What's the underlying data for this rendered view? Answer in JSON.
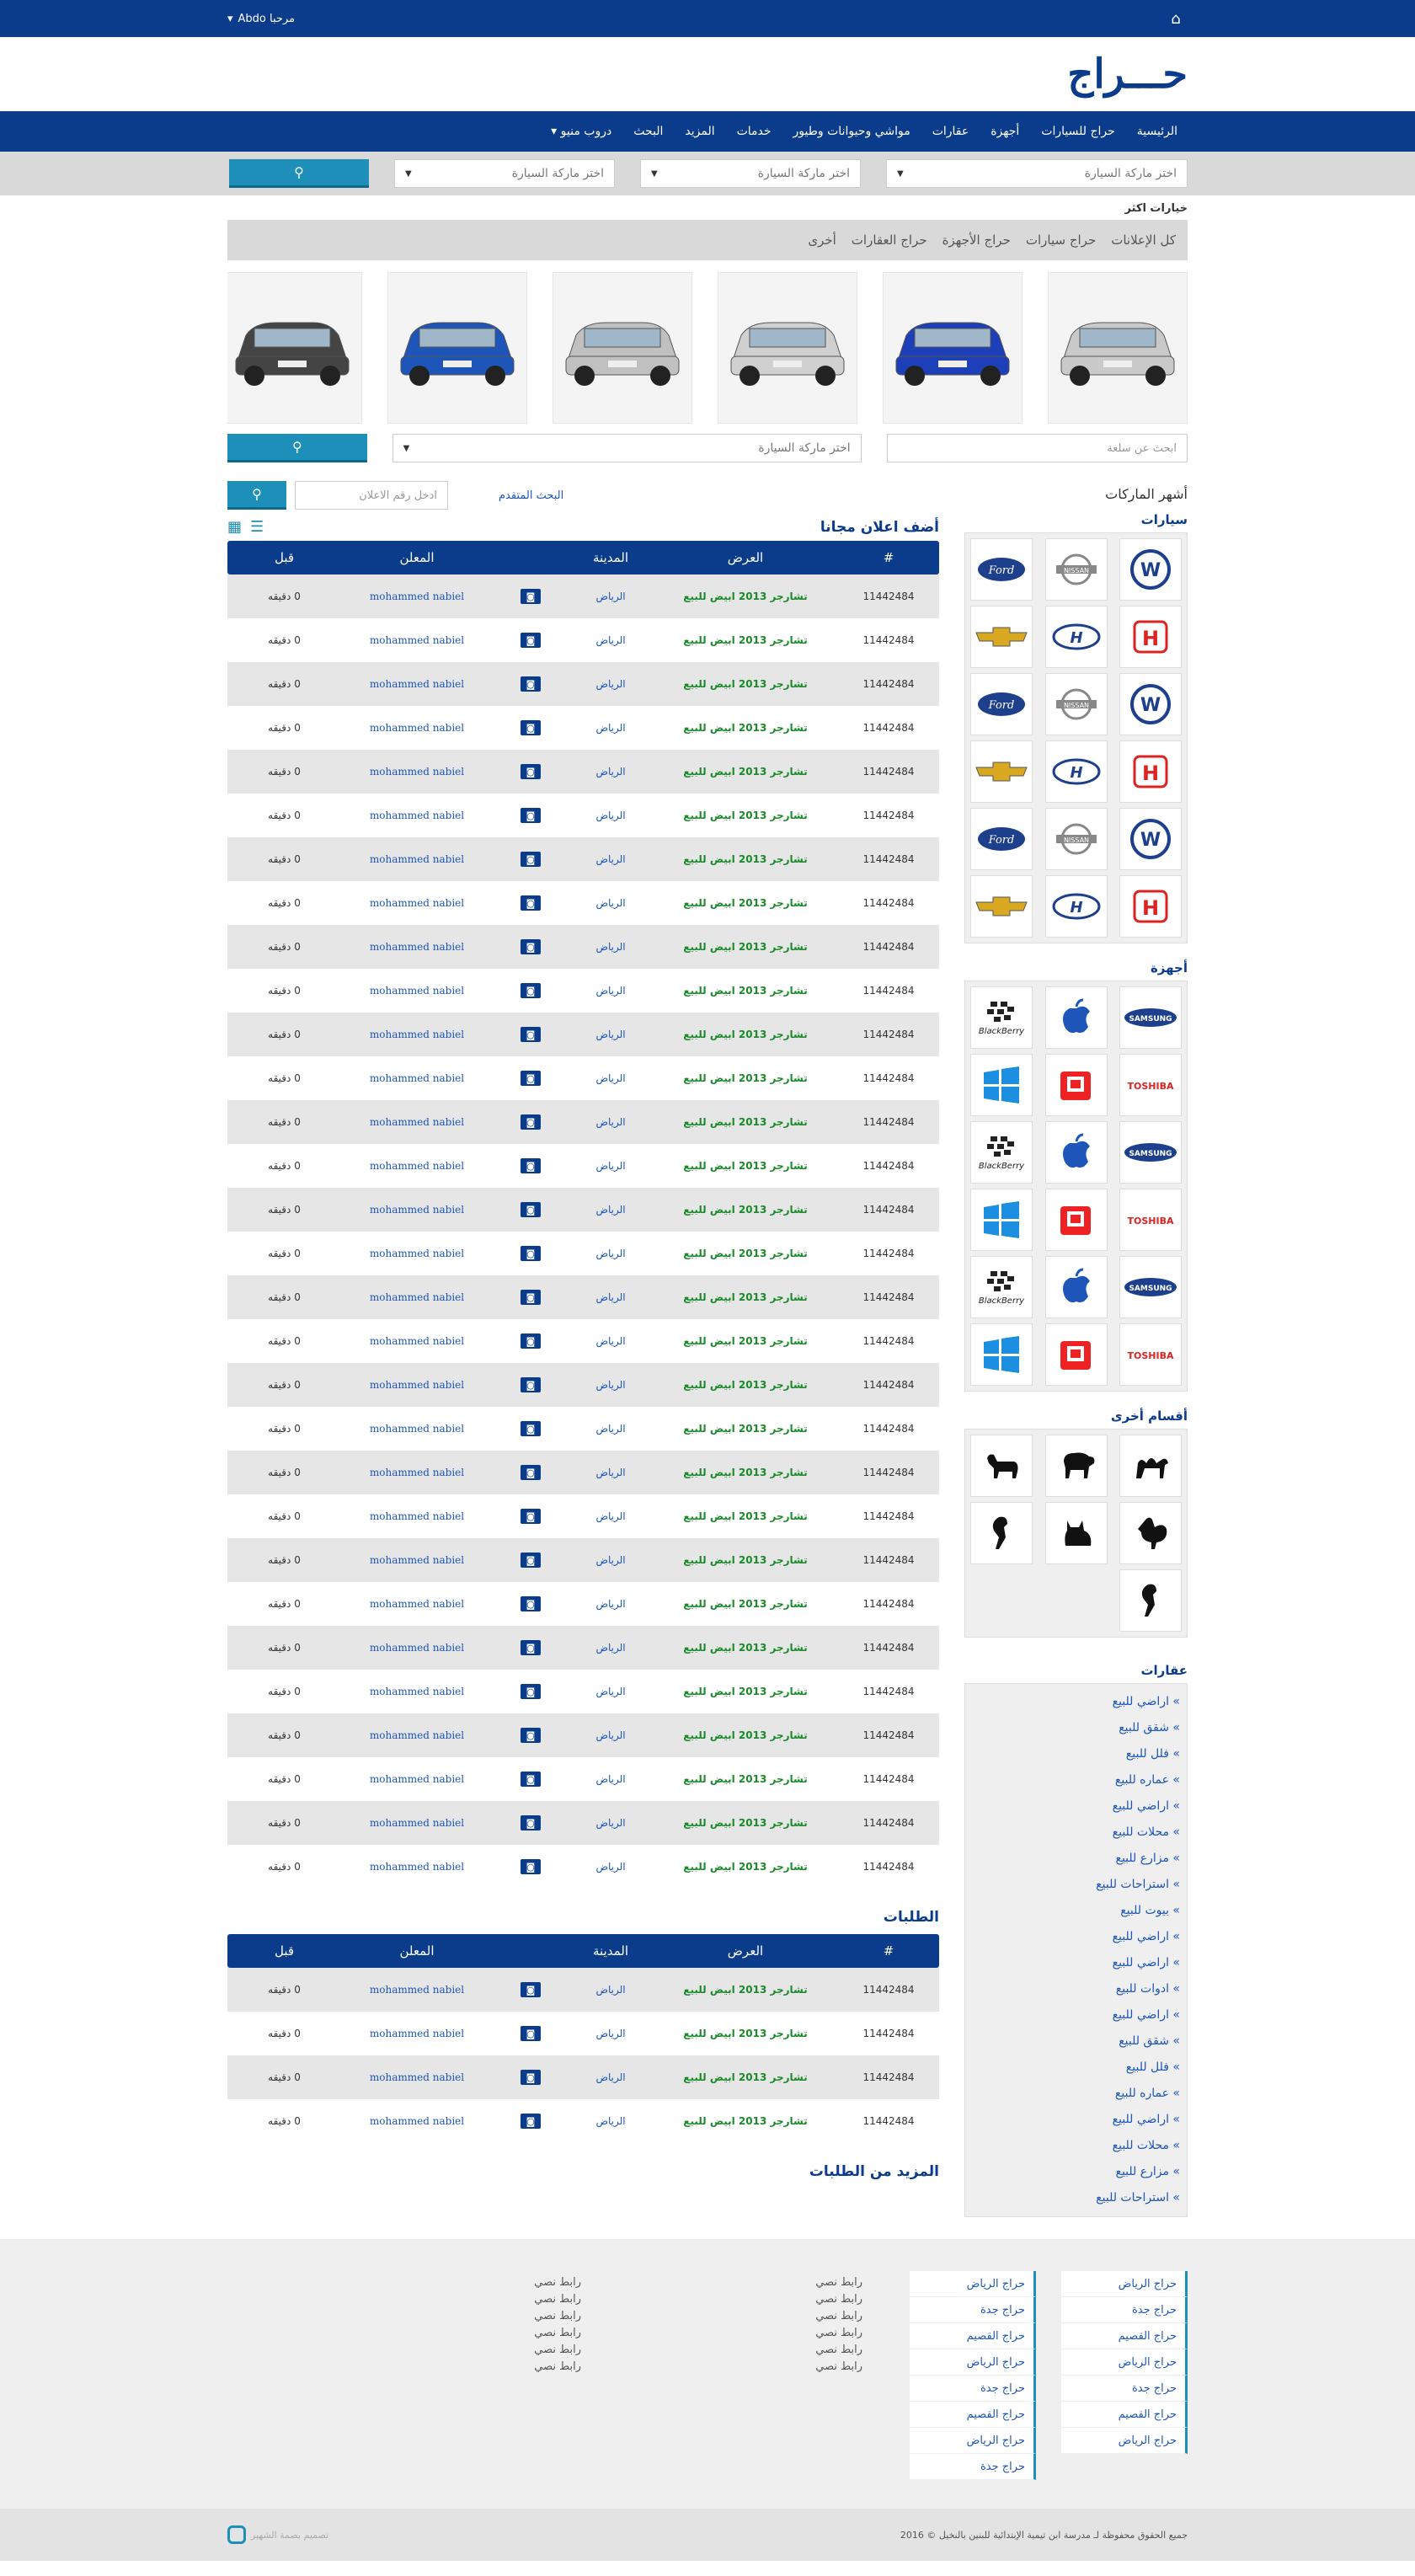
{
  "topbar": {
    "greeting": "مرحبا Abdo",
    "caret": "▾"
  },
  "logo": {
    "text": "حـــراج"
  },
  "nav": [
    "الرئيسية",
    "حراج للسيارات",
    "أجهزة",
    "عقارات",
    "مواشي وحيوانات وطيور",
    "خدمات",
    "المزيد",
    "البحث",
    "دروب منيو ▾"
  ],
  "search": {
    "select1": "اختر ماركة السيارة",
    "select2": "اختر ماركة السيارة",
    "select3": "اختر ماركة السيارة",
    "more": "خيارات اكثر"
  },
  "cattabs": [
    "كل الإعلانات",
    "حراج سيارات",
    "حراج الأجهزة",
    "حراج العقارات",
    "أخرى"
  ],
  "row2": {
    "text_placeholder": "ابحث عن سلعة",
    "select": "اختر ماركة السيارة"
  },
  "sidebar": {
    "title": "أشهر الماركات",
    "cars_title": "سيارات",
    "devices_title": "أجهزة",
    "other_title": "أقسام أخرى",
    "realestate_title": "عقارات",
    "car_logos": [
      "vw",
      "nissan",
      "ford",
      "honda",
      "hyundai",
      "chevrolet",
      "vw",
      "nissan",
      "ford",
      "honda",
      "hyundai",
      "chevrolet",
      "vw",
      "nissan",
      "ford",
      "honda",
      "hyundai",
      "chevrolet"
    ],
    "device_logos": [
      "samsung",
      "apple",
      "blackberry",
      "toshiba",
      "huawei",
      "windows",
      "samsung",
      "apple",
      "blackberry",
      "toshiba",
      "huawei",
      "windows",
      "samsung",
      "apple",
      "blackberry",
      "toshiba",
      "huawei",
      "windows"
    ],
    "animals": [
      "camel-icon",
      "sheep-icon",
      "goat-icon",
      "rooster-icon",
      "cat-icon",
      "parrot-icon",
      "parrot-icon"
    ],
    "realestate": [
      "» اراضي للبيع",
      "» شقق للبيع",
      "» فلل للبيع",
      "» عماره للبيع",
      "» اراضي للبيع",
      "» محلات للبيع",
      "» مزارع للبيع",
      "» استراحات للبيع",
      "» بيوت للبيع",
      "» اراضي للبيع",
      "» اراضي للبيع",
      "» ادوات للبيع",
      "» اراضي للبيع",
      "» شقق للبيع",
      "» فلل للبيع",
      "» عماره للبيع",
      "» اراضي للبيع",
      "» محلات للبيع",
      "» مزارع للبيع",
      "» استراحات للبيع"
    ]
  },
  "content": {
    "adv_search": "البحث المتقدم",
    "ad_number_placeholder": "ادخل رقم الاعلان",
    "add_free": "أضف اعلان مجانا",
    "requests_title": "الطلبات",
    "more_requests": "المزيد من الطلبات",
    "headers": {
      "num": "#",
      "offer": "العرض",
      "city": "المدينة",
      "advertiser": "المعلن",
      "before": "قبل"
    },
    "row": {
      "num": "11442484",
      "offer": "تشارجر 2013 ابيض للبيع",
      "city": "الرياض",
      "advertiser": "mohammed nabiel",
      "before": "0 دقيقه"
    }
  },
  "footer": {
    "col1": [
      "حراج الرياض",
      "حراج جدة",
      "حراج القصيم",
      "حراج الرياض",
      "حراج جدة",
      "حراج القصيم",
      "حراج الرياض"
    ],
    "col2": [
      "حراج الرياض",
      "حراج جدة",
      "حراج القصيم",
      "حراج الرياض",
      "حراج جدة",
      "حراج القصيم",
      "حراج الرياض",
      "حراج جدة"
    ],
    "col3": [
      "رابط نصي",
      "رابط نصي",
      "رابط نصي",
      "رابط نصي",
      "رابط نصي",
      "رابط نصي"
    ],
    "col4": [
      "رابط نصي",
      "رابط نصي",
      "رابط نصي",
      "رابط نصي",
      "رابط نصي",
      "رابط نصي"
    ],
    "copyright": "جميع الحقوق محفوظة لـ مدرسة ابن تيمية الإبتدائية للبنين بالنخيل © 2016",
    "design": "تصميم بصمة الشهير"
  }
}
